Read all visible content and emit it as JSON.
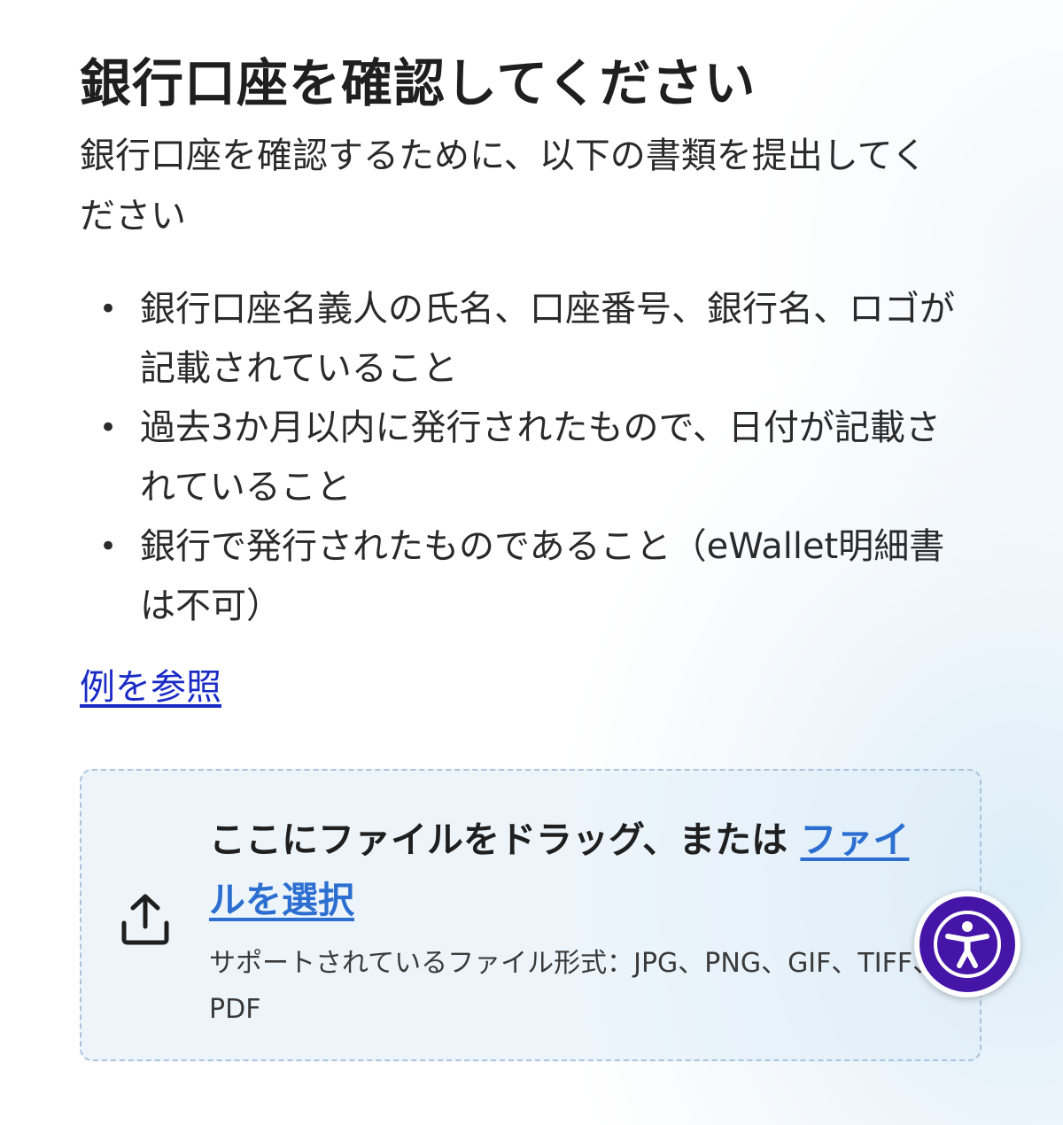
{
  "header": {
    "title": "銀行口座を確認してください",
    "subtitle": "銀行口座を確認するために、以下の書類を提出してください"
  },
  "requirements": {
    "items": [
      "銀行口座名義人の氏名、口座番号、銀行名、ロゴが記載されていること",
      "過去3か月以内に発行されたもので、日付が記載されていること",
      "銀行で発行されたものであること（eWallet明細書は不可）"
    ]
  },
  "example_link": "例を参照",
  "upload": {
    "prompt": "ここにファイルをドラッグ、または ",
    "select_link": "ファイルを選択",
    "formats": "サポートされているファイル形式：JPG、PNG、GIF、TIFF、PDF",
    "icon": "upload-icon"
  },
  "accessibility": {
    "icon": "accessibility-icon",
    "color": "#4515a8"
  },
  "colors": {
    "link": "#1a2bc6",
    "upload_link": "#2c6fd1",
    "dropzone_border": "#a9c3dc"
  }
}
